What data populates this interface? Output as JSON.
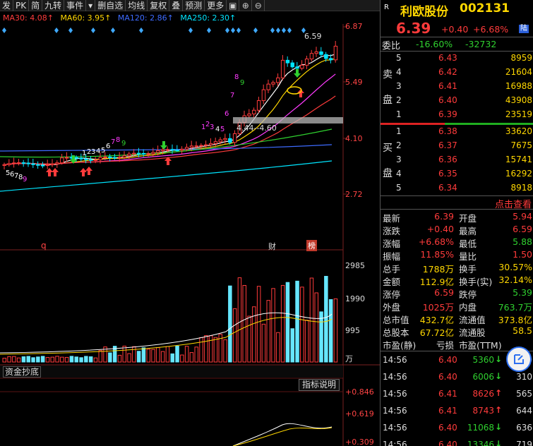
{
  "toolbar": {
    "items": [
      "发",
      "PK",
      "简",
      "九转",
      "事件",
      "▾",
      "删自选",
      "均线",
      "复权",
      "叠",
      "预测",
      "更多"
    ],
    "icons": [
      "window-split-icon",
      "plus-icon",
      "minus-icon"
    ]
  },
  "ma": {
    "ma30": "MA30: 4.08↑",
    "ma60": "MA60: 3.95↑",
    "ma120": "MA120: 2.86↑",
    "ma250": "MA250: 2.30↑",
    "colors": {
      "ma30": "#ff3b3b",
      "ma60": "#ffd700",
      "ma120": "#3d6bff",
      "ma250": "#00e5ff"
    }
  },
  "price_axis": [
    "6.87",
    "5.49",
    "4.10",
    "2.72"
  ],
  "vol_axis": [
    "2985",
    "1990",
    "995",
    "万"
  ],
  "ind_axis": [
    "+0.846",
    "+0.619",
    "+0.309"
  ],
  "chart_labels": {
    "high_marker": "6.59",
    "range_label": "4.44--4.60",
    "q_tag": "q",
    "cai_tag": "财",
    "bang_tag": "榜"
  },
  "indicator": {
    "title": "资金抄底",
    "help": "指标说明"
  },
  "quote": {
    "badge": "R",
    "name": "利欧股份",
    "code": "002131",
    "price": "6.39",
    "change": "+0.40",
    "change_pct": "+6.68%",
    "market": "陆"
  },
  "weibi": {
    "label": "委比",
    "pct": "-16.60%",
    "diff": "-32732"
  },
  "asks": [
    {
      "lvl": "5",
      "price": "6.43",
      "vol": "8959"
    },
    {
      "lvl": "4",
      "price": "6.42",
      "vol": "21604"
    },
    {
      "lvl": "3",
      "price": "6.41",
      "vol": "16988"
    },
    {
      "lvl": "2",
      "price": "6.40",
      "vol": "43908"
    },
    {
      "lvl": "1",
      "price": "6.39",
      "vol": "23519"
    }
  ],
  "ask_side_label": [
    "卖",
    "盘"
  ],
  "bids": [
    {
      "lvl": "1",
      "price": "6.38",
      "vol": "33620"
    },
    {
      "lvl": "2",
      "price": "6.37",
      "vol": "7675"
    },
    {
      "lvl": "3",
      "price": "6.36",
      "vol": "15741"
    },
    {
      "lvl": "4",
      "price": "6.35",
      "vol": "16292"
    },
    {
      "lvl": "5",
      "price": "6.34",
      "vol": "8918"
    }
  ],
  "bid_side_label": [
    "买",
    "盘"
  ],
  "view_more": "点击查看",
  "stats": [
    {
      "l1": "最新",
      "v1": "6.39",
      "c1": "red",
      "l2": "开盘",
      "v2": "5.94",
      "c2": "red"
    },
    {
      "l1": "涨跌",
      "v1": "+0.40",
      "c1": "red",
      "l2": "最高",
      "v2": "6.59",
      "c2": "red"
    },
    {
      "l1": "涨幅",
      "v1": "+6.68%",
      "c1": "red",
      "l2": "最低",
      "v2": "5.88",
      "c2": "green"
    },
    {
      "l1": "振幅",
      "v1": "11.85%",
      "c1": "red",
      "l2": "量比",
      "v2": "1.50",
      "c2": "red"
    },
    {
      "l1": "总手",
      "v1": "1788万",
      "c1": "yellow",
      "l2": "换手",
      "v2": "30.57%",
      "c2": "yellow"
    },
    {
      "l1": "金额",
      "v1": "112.9亿",
      "c1": "yellow",
      "l2": "换手(实)",
      "v2": "32.14%",
      "c2": "yellow"
    },
    {
      "l1": "涨停",
      "v1": "6.59",
      "c1": "red",
      "l2": "跌停",
      "v2": "5.39",
      "c2": "green"
    },
    {
      "l1": "外盘",
      "v1": "1025万",
      "c1": "red",
      "l2": "内盘",
      "v2": "763.7万",
      "c2": "green"
    },
    {
      "l1": "总市值",
      "v1": "432.7亿",
      "c1": "yellow",
      "l2": "流通值",
      "v2": "373.8亿",
      "c2": "yellow"
    },
    {
      "l1": "总股本",
      "v1": "67.72亿",
      "c1": "yellow",
      "l2": "流通股",
      "v2": "58.5",
      "c2": "yellow"
    },
    {
      "l1": "市盈(静)",
      "v1": "亏损",
      "c1": "white",
      "l2": "市盈(TTM)",
      "v2": "",
      "c2": "yellow"
    }
  ],
  "ticks": [
    {
      "time": "14:56",
      "price": "6.40",
      "vol": "5360",
      "dir": "down",
      "n": "269"
    },
    {
      "time": "14:56",
      "price": "6.40",
      "vol": "6006",
      "dir": "down",
      "n": "310"
    },
    {
      "time": "14:56",
      "price": "6.41",
      "vol": "8626",
      "dir": "up",
      "n": "565"
    },
    {
      "time": "14:56",
      "price": "6.41",
      "vol": "8743",
      "dir": "up",
      "n": "644"
    },
    {
      "time": "14:56",
      "price": "6.40",
      "vol": "11068",
      "dir": "down",
      "n": "636"
    },
    {
      "time": "14:56",
      "price": "6.40",
      "vol": "13346",
      "dir": "down",
      "n": "719"
    }
  ]
}
